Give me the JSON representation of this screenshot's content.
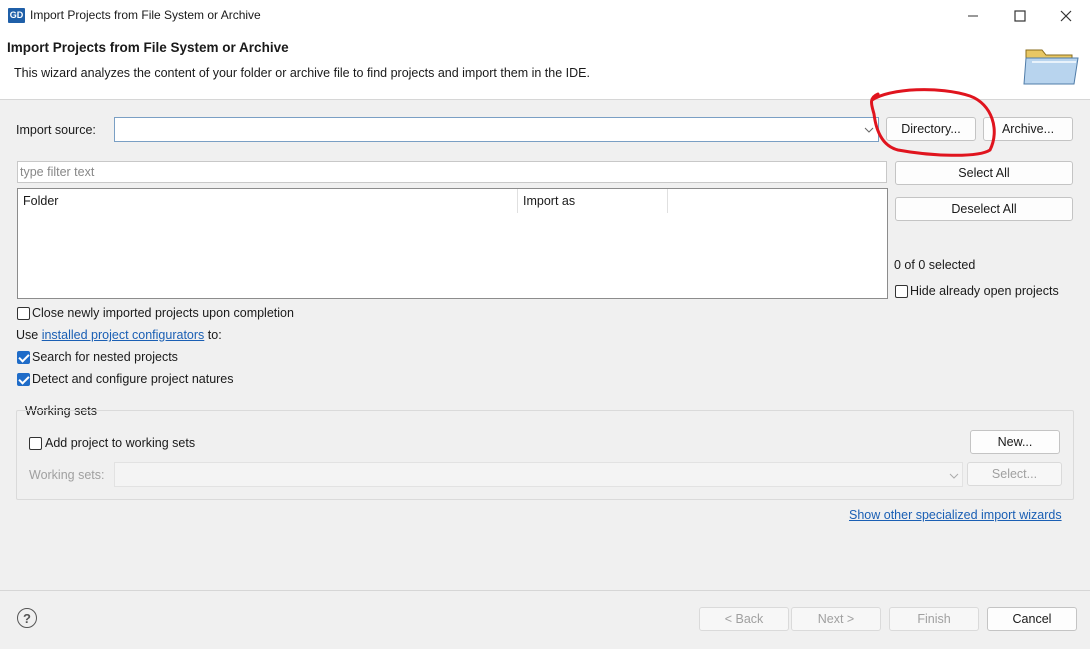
{
  "window": {
    "app_icon_text": "GD",
    "title": "Import Projects from File System or Archive",
    "controls": [
      "minimize-icon",
      "maximize-icon",
      "close-icon"
    ]
  },
  "header": {
    "title": "Import Projects from File System or Archive",
    "description": "This wizard analyzes the content of your folder or archive file to find projects and import them in the IDE.",
    "icon": "folder-icon"
  },
  "import_source": {
    "label": "Import source:",
    "value": "",
    "directory_button": "Directory...",
    "archive_button": "Archive..."
  },
  "filter": {
    "placeholder": "type filter text"
  },
  "table": {
    "columns": [
      "Folder",
      "Import as"
    ],
    "rows": []
  },
  "side_buttons": {
    "select_all": "Select All",
    "deselect_all": "Deselect All",
    "selection_count": "0 of 0 selected",
    "hide_open_label": "Hide already open projects",
    "hide_open_checked": false
  },
  "options": {
    "close_projects_label": "Close newly imported projects upon completion",
    "close_projects_checked": false,
    "use_prefix": "Use ",
    "configurators_link": "installed project configurators",
    "use_suffix": " to:",
    "search_nested_label": "Search for nested projects",
    "search_nested_checked": true,
    "detect_natures_label": "Detect and configure project natures",
    "detect_natures_checked": true
  },
  "working_sets": {
    "group_label": "Working sets",
    "add_label": "Add project to working sets",
    "add_checked": false,
    "new_button": "New...",
    "sets_label": "Working sets:",
    "select_button": "Select..."
  },
  "other_wizards_link": "Show other specialized import wizards",
  "footer": {
    "help": "?",
    "back": "< Back",
    "next": "Next >",
    "finish": "Finish",
    "cancel": "Cancel"
  },
  "colors": {
    "annotation": "#e0141e",
    "link": "#1a5fb4",
    "checkbox_checked": "#1f6cc8"
  }
}
